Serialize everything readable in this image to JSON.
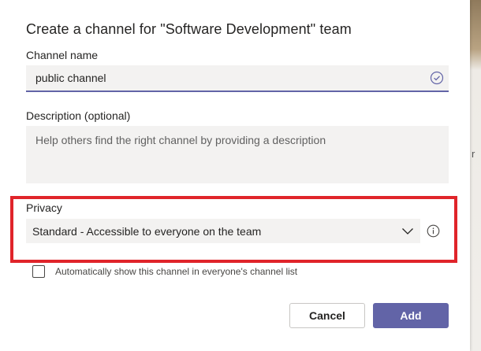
{
  "background": {
    "fragment_text": "r"
  },
  "dialog": {
    "title": "Create a channel for \"Software Development\" team",
    "channel_name": {
      "label": "Channel name",
      "value": "public channel"
    },
    "description": {
      "label": "Description (optional)",
      "placeholder": "Help others find the right channel by providing a description"
    },
    "privacy": {
      "label": "Privacy",
      "selected": "Standard - Accessible to everyone on the team"
    },
    "auto_show": {
      "label": "Automatically show this channel in everyone's channel list",
      "checked": false
    },
    "buttons": {
      "cancel": "Cancel",
      "add": "Add"
    }
  },
  "colors": {
    "accent": "#6264a7",
    "highlight_border": "#e0242a",
    "field_background": "#f3f2f1"
  },
  "icons": [
    "check-circle-icon",
    "chevron-down-icon",
    "info-icon"
  ]
}
